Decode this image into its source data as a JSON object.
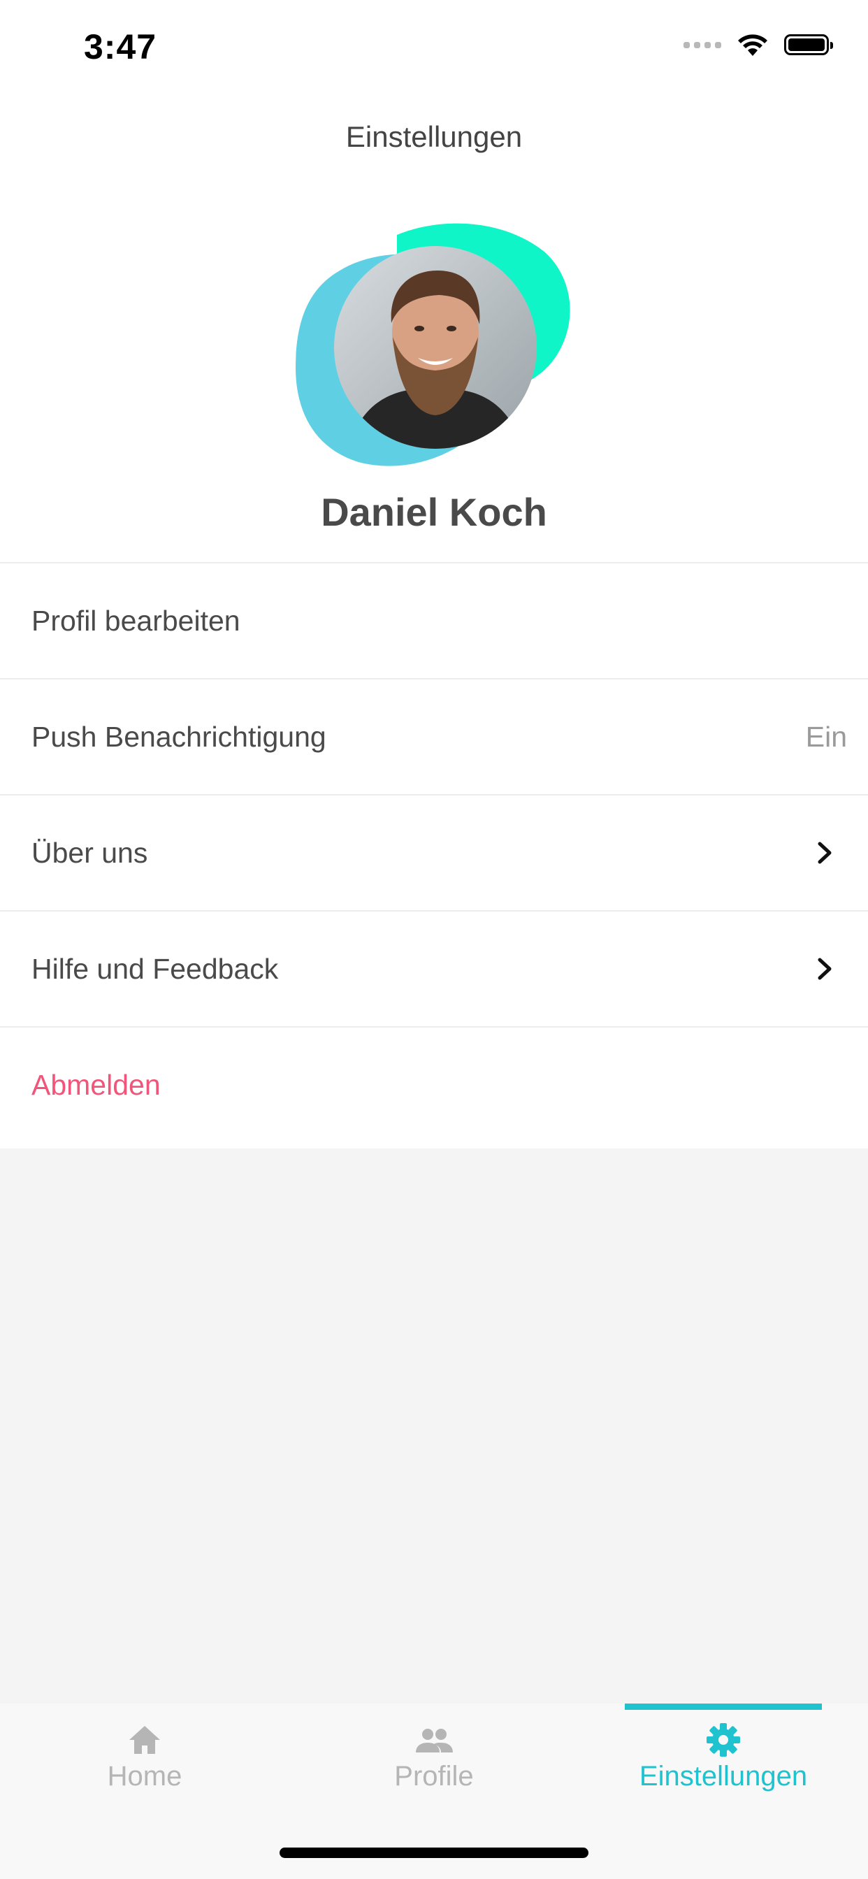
{
  "status_bar": {
    "time": "3:47"
  },
  "header": {
    "title": "Einstellungen"
  },
  "profile": {
    "name": "Daniel Koch",
    "avatar_colors": {
      "blob_blue": "#5fd0e4",
      "blob_green": "#0ff5c8"
    }
  },
  "menu": {
    "items": [
      {
        "label": "Profil bearbeiten"
      },
      {
        "label": "Push Benachrichtigung",
        "value": "Ein"
      },
      {
        "label": "Über uns",
        "icon": "chevron-right-icon"
      },
      {
        "label": "Hilfe und Feedback",
        "icon": "chevron-right-icon"
      },
      {
        "label": "Abmelden",
        "color": "#f2557a"
      }
    ]
  },
  "tabbar": {
    "tabs": [
      {
        "label": "Home",
        "icon": "home-icon"
      },
      {
        "label": "Profile",
        "icon": "people-icon"
      },
      {
        "label": "Einstellungen",
        "icon": "gear-icon",
        "active": true
      }
    ],
    "active_color": "#1ec3cf",
    "inactive_color": "#b5b5b5"
  }
}
